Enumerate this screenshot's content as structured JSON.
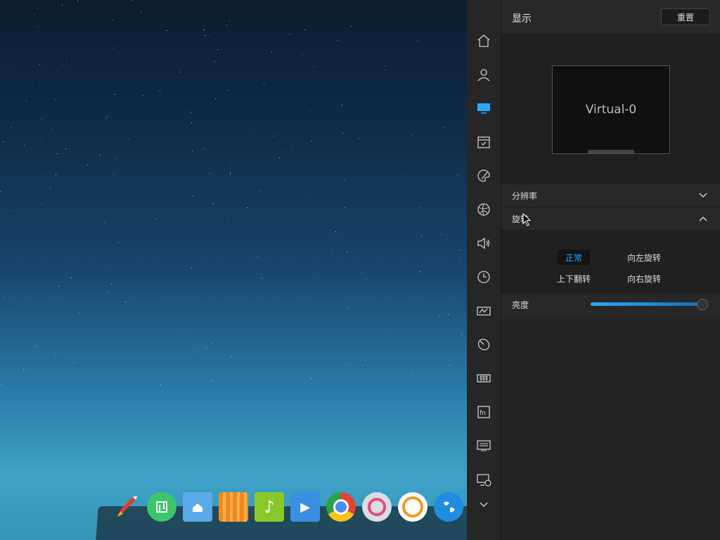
{
  "panel": {
    "title": "显示",
    "reset_label": "重置",
    "monitor_name": "Virtual-0",
    "resolution_label": "分辨率",
    "rotation_label": "旋转",
    "rotation_options": {
      "normal": "正常",
      "rotate_left": "向左旋转",
      "flip": "上下翻转",
      "rotate_right": "向右旋转"
    },
    "selected_rotation": "正常",
    "brightness_label": "亮度",
    "brightness_level": 0.99
  },
  "sidebar": {
    "items": [
      "home-icon",
      "user-icon",
      "display-icon",
      "calendar-icon",
      "personalization-icon",
      "network-icon",
      "sound-icon",
      "clock-icon",
      "power-icon",
      "mouse-icon",
      "keyboard-icon",
      "fn-keys-icon",
      "system-info-icon",
      "update-icon",
      "more-chevron-icon"
    ],
    "active": "display-icon",
    "accent_color": "#2ca7f8"
  },
  "dock": {
    "apps": [
      "launcher-icon",
      "deepin-store-icon",
      "file-manager-icon",
      "app-store-icon",
      "music-icon",
      "movie-icon",
      "chrome-icon",
      "settings-icon",
      "screen-recorder-icon",
      "browser-icon"
    ]
  }
}
